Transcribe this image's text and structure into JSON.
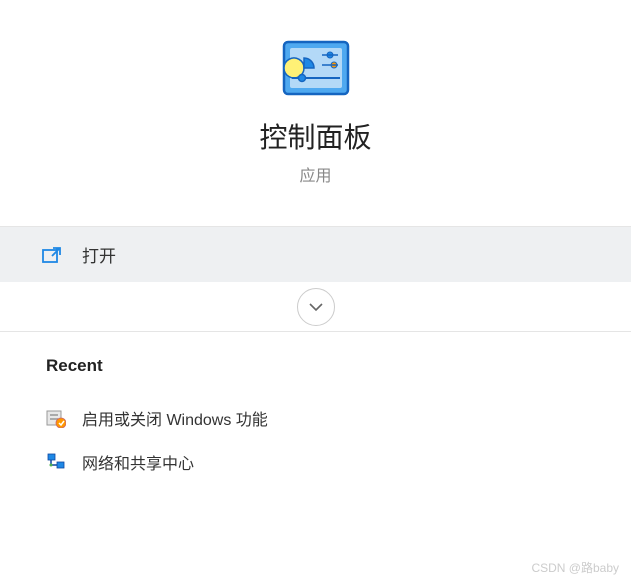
{
  "app": {
    "title": "控制面板",
    "category": "应用"
  },
  "actions": {
    "open_label": "打开"
  },
  "recent": {
    "heading": "Recent",
    "items": [
      {
        "label": "启用或关闭 Windows 功能",
        "icon": "windows-features-icon"
      },
      {
        "label": "网络和共享中心",
        "icon": "network-sharing-icon"
      }
    ]
  },
  "watermark": "CSDN @路baby",
  "colors": {
    "accent_blue": "#1e88e5",
    "icon_border": "#1565c0",
    "open_bg": "#eef0f2"
  }
}
